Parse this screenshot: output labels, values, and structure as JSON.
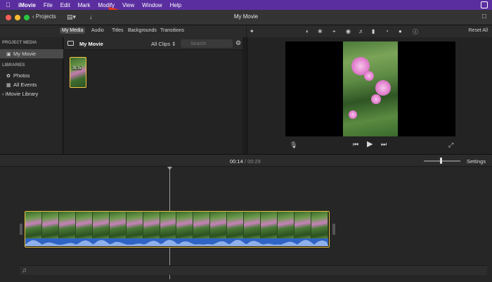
{
  "menubar": {
    "app": "iMovie",
    "items": [
      "File",
      "Edit",
      "Mark",
      "Modify",
      "View",
      "Window",
      "Help"
    ]
  },
  "toolbar": {
    "projects_label": "Projects",
    "window_title": "My Movie"
  },
  "browser_tabs": [
    "My Media",
    "Audio",
    "Titles",
    "Backgrounds",
    "Transitions"
  ],
  "viewer_toolbar": {
    "reset_all_label": "Reset All"
  },
  "sidebar": {
    "project_media_heading": "PROJECT MEDIA",
    "project_item": "My Movie",
    "libraries_heading": "LIBRARIES",
    "items": [
      "Photos",
      "All Events",
      "iMovie Library"
    ]
  },
  "browser": {
    "title": "My Movie",
    "filter": "All Clips",
    "search_placeholder": "Search",
    "clip_duration": "29.7s"
  },
  "timeline": {
    "current_time": "00:14",
    "separator": "/",
    "total_time": "00:29",
    "settings_label": "Settings",
    "zoom_level": 0.45
  },
  "colors": {
    "menubar": "#5b2ea0",
    "selection_border": "#e8c23a",
    "audio_waveform": "#2f63c4",
    "arrow": "#e8341c"
  }
}
